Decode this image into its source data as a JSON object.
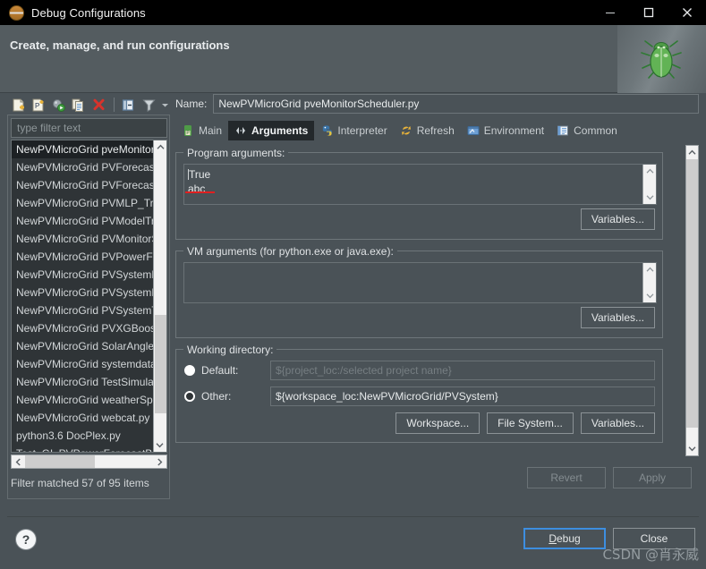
{
  "window": {
    "title": "Debug Configurations",
    "icon": "eclipse-debug-icon",
    "minimize_label": "–",
    "maximize_label": "□",
    "close_label": "✕"
  },
  "header": {
    "title": "Create, manage, and run configurations",
    "art_icon": "green-bug-icon"
  },
  "left_panel": {
    "toolbar": [
      {
        "name": "new-launch-configuration-icon",
        "tooltip": "New launch configuration"
      },
      {
        "name": "new-prototype-icon",
        "tooltip": "New prototype"
      },
      {
        "name": "export-icon",
        "tooltip": "Export"
      },
      {
        "name": "duplicate-icon",
        "tooltip": "Duplicate"
      },
      {
        "name": "delete-icon",
        "tooltip": "Delete"
      },
      {
        "name": "collapse-all-icon",
        "tooltip": "Collapse All"
      },
      {
        "name": "filter-icon",
        "tooltip": "Filter launch configurations"
      },
      {
        "name": "view-menu-caret-icon",
        "tooltip": "View Menu"
      }
    ],
    "filter_placeholder": "type filter text",
    "filter_value": "",
    "items": [
      "NewPVMicroGrid pveMonitorScheduler.py",
      "NewPVMicroGrid PVForecastBP.py",
      "NewPVMicroGrid PVForecastLSTM.py",
      "NewPVMicroGrid PVMLP_Train.py",
      "NewPVMicroGrid PVModelTrain.py",
      "NewPVMicroGrid PVMonitorScheduler.py",
      "NewPVMicroGrid PVPowerForecast.py",
      "NewPVMicroGrid PVSystemDataETL.py",
      "NewPVMicroGrid PVSystemMonitor.py",
      "NewPVMicroGrid PVSystemTest.py",
      "NewPVMicroGrid PVXGBoost.py",
      "NewPVMicroGrid SolarAngle.py",
      "NewPVMicroGrid systemdata.py",
      "NewPVMicroGrid TestSimulation.py",
      "NewPVMicroGrid weatherSpider.py",
      "NewPVMicroGrid webcat.py",
      "python3.6 DocPlex.py",
      "Test_GL PVPowerForecastBP.py"
    ],
    "selected_index": 0,
    "filter_status": "Filter matched 57 of 95 items"
  },
  "form": {
    "name_label": "Name:",
    "name_value": "NewPVMicroGrid pveMonitorScheduler.py",
    "tabs": [
      {
        "label": "Main",
        "icon": "python-main-icon",
        "active": false
      },
      {
        "label": "Arguments",
        "icon": "arguments-icon",
        "active": true
      },
      {
        "label": "Interpreter",
        "icon": "python-interpreter-icon",
        "active": false
      },
      {
        "label": "Refresh",
        "icon": "refresh-icon",
        "active": false
      },
      {
        "label": "Environment",
        "icon": "environment-icon",
        "active": false
      },
      {
        "label": "Common",
        "icon": "common-icon",
        "active": false
      }
    ],
    "program_arguments": {
      "legend": "Program arguments:",
      "lines": [
        "True",
        "abc"
      ],
      "annotation_underline_color": "#e02020",
      "variables_button": "Variables..."
    },
    "vm_arguments": {
      "legend": "VM arguments (for python.exe or java.exe):",
      "value": "",
      "variables_button": "Variables..."
    },
    "working_directory": {
      "legend": "Working directory:",
      "default_label": "Default:",
      "default_placeholder": "${project_loc:/selected project name}",
      "other_label": "Other:",
      "other_value": "${workspace_loc:NewPVMicroGrid/PVSystem}",
      "selected": "other",
      "workspace_button": "Workspace...",
      "file_system_button": "File System...",
      "variables_button": "Variables..."
    },
    "revert_button": "Revert",
    "apply_button": "Apply",
    "revert_enabled": false,
    "apply_enabled": false
  },
  "footer": {
    "help_label": "?",
    "debug_button": "Debug",
    "debug_mnemonic": "D",
    "debug_rest": "ebug",
    "close_button": "Close"
  },
  "watermark": "CSDN @肖永威",
  "colors": {
    "window_bg": "#4a5257",
    "header_bg": "#545c60",
    "titlebar_bg": "#000000",
    "list_bg": "#2f3437",
    "selection_bg": "#1d2124",
    "accent_focus": "#3d8ee0",
    "annotation_red": "#e02020",
    "text_primary": "#e6e9ea",
    "text_muted": "#8e9699"
  }
}
